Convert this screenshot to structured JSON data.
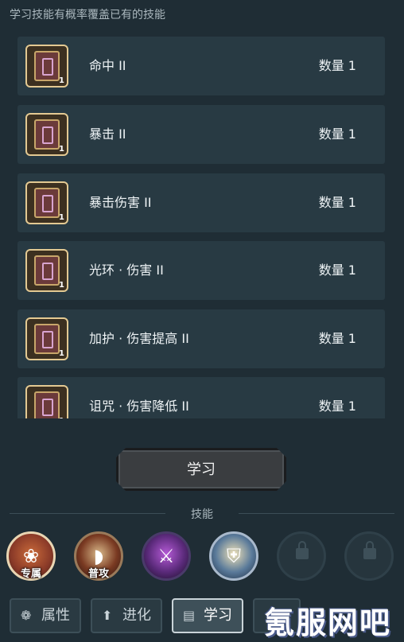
{
  "hint": "学习技能有概率覆盖已有的技能",
  "skill_books": [
    {
      "name": "命中 II",
      "count_badge": "1",
      "quantity": "数量 1"
    },
    {
      "name": "暴击 II",
      "count_badge": "1",
      "quantity": "数量 1"
    },
    {
      "name": "暴击伤害 II",
      "count_badge": "1",
      "quantity": "数量 1"
    },
    {
      "name": "光环 · 伤害 II",
      "count_badge": "1",
      "quantity": "数量 1"
    },
    {
      "name": "加护 · 伤害提高 II",
      "count_badge": "1",
      "quantity": "数量 1"
    },
    {
      "name": "诅咒 · 伤害降低 II",
      "count_badge": "1",
      "quantity": "数量 1"
    }
  ],
  "learn_button": "学习",
  "skills_section_title": "技能",
  "skill_slots": [
    {
      "label": "专属",
      "icon": "exclusive-skill-icon",
      "locked": false
    },
    {
      "label": "普攻",
      "icon": "basic-attack-icon",
      "locked": false
    },
    {
      "label": "",
      "icon": "purple-sword-icon",
      "locked": false
    },
    {
      "label": "",
      "icon": "winged-shield-icon",
      "locked": false
    },
    {
      "label": "",
      "icon": "lock-icon",
      "locked": true
    },
    {
      "label": "",
      "icon": "lock-icon",
      "locked": true
    }
  ],
  "bottom_tabs": [
    {
      "label": "属性",
      "icon": "paw-icon"
    },
    {
      "label": "进化",
      "icon": "arrow-up-icon"
    },
    {
      "label": "学习",
      "icon": "book-icon",
      "active": true
    }
  ],
  "watermark": "氪服网吧",
  "colors": {
    "background": "#1f2d35",
    "row": "#283a43",
    "book_border": "#e3c992"
  }
}
